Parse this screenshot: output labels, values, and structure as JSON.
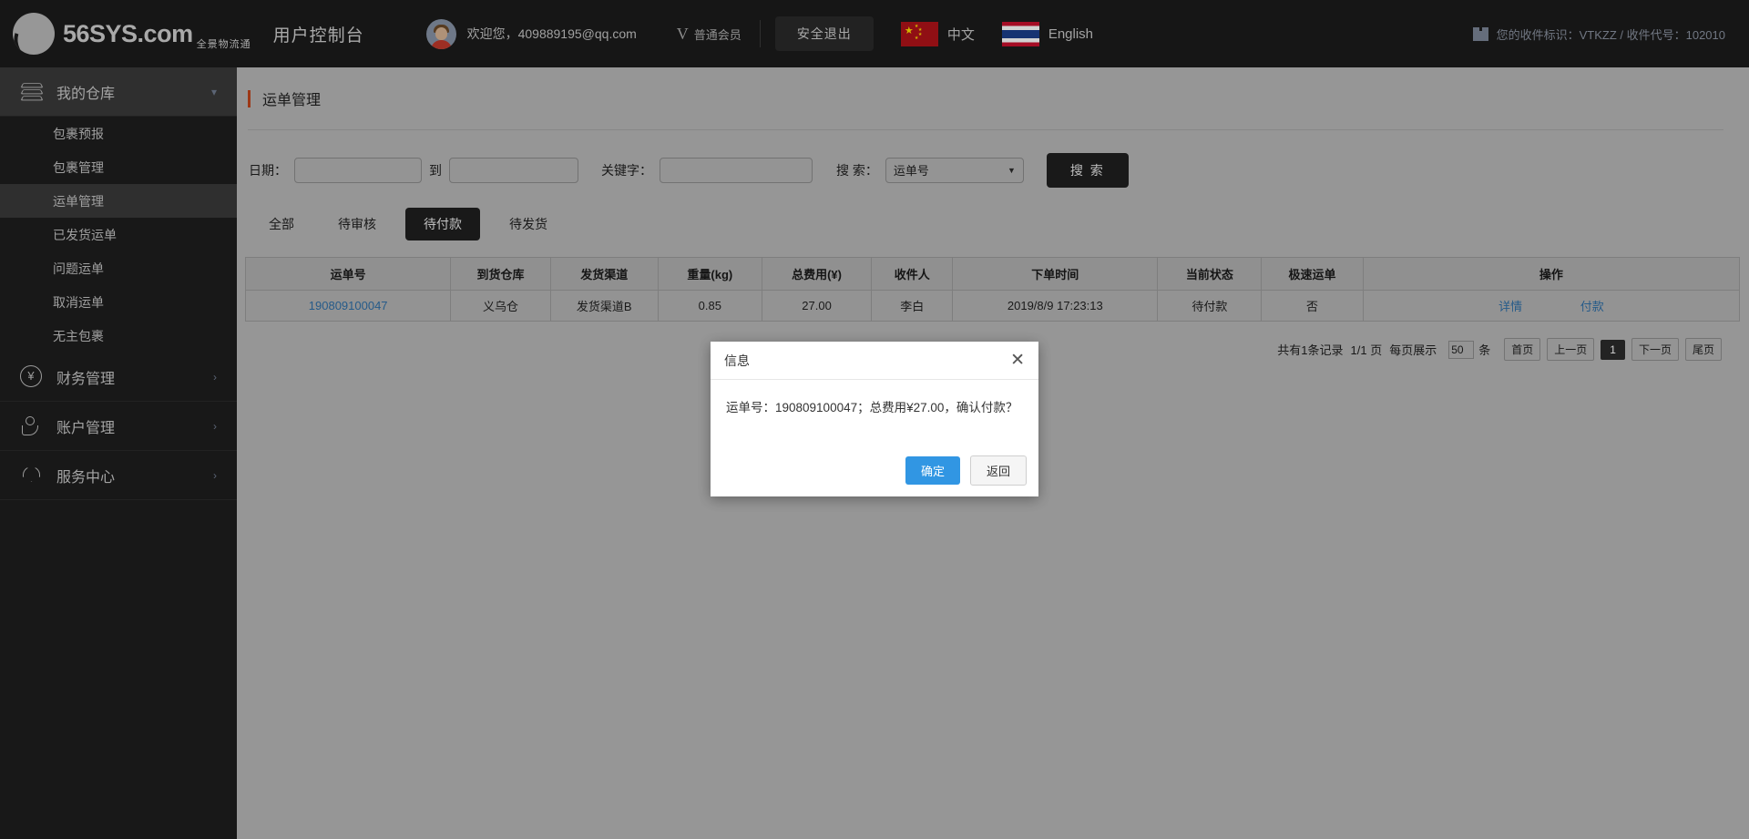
{
  "header": {
    "logo_text": "56SYS.com",
    "logo_sub": "全景物流通",
    "console_title": "用户控制台",
    "welcome": "欢迎您，409889195@qq.com",
    "vip_icon": "V",
    "vip_level": "普通会员",
    "logout_label": "安全退出",
    "languages": [
      {
        "flag": "cn-flag-icon",
        "label": "中文"
      },
      {
        "flag": "th-flag-icon",
        "label": "English"
      }
    ],
    "identity": "您的收件标识：VTKZZ / 收件代号：102010",
    "identity_icon": "box-icon"
  },
  "sidebar": {
    "groups": [
      {
        "label": "我的仓库",
        "icon": "layers-icon",
        "chevron": "chevron-down-icon",
        "active": true,
        "items": [
          {
            "label": "包裹预报",
            "active": false
          },
          {
            "label": "包裹管理",
            "active": false
          },
          {
            "label": "运单管理",
            "active": true
          },
          {
            "label": "已发货运单",
            "active": false
          },
          {
            "label": "问题运单",
            "active": false
          },
          {
            "label": "取消运单",
            "active": false
          },
          {
            "label": "无主包裹",
            "active": false
          }
        ]
      },
      {
        "label": "财务管理",
        "icon": "yen-circle-icon",
        "chevron": "chevron-right-icon",
        "active": false,
        "items": []
      },
      {
        "label": "账户管理",
        "icon": "user-icon",
        "chevron": "chevron-right-icon",
        "active": false,
        "items": []
      },
      {
        "label": "服务中心",
        "icon": "shield-icon",
        "chevron": "chevron-right-icon",
        "active": false,
        "items": []
      }
    ]
  },
  "main": {
    "page_title": "运单管理",
    "filters": {
      "date_label": "日期：",
      "date_from_value": "",
      "date_to_label": "到",
      "date_to_value": "",
      "keyword_label": "关键字：",
      "keyword_value": "",
      "search_type_label": "搜 索：",
      "search_type_value": "运单号",
      "search_type_options": [
        "运单号"
      ],
      "search_button": "搜 索"
    },
    "tabs": [
      {
        "label": "全部",
        "active": false
      },
      {
        "label": "待审核",
        "active": false
      },
      {
        "label": "待付款",
        "active": true
      },
      {
        "label": "待发货",
        "active": false
      }
    ],
    "table": {
      "columns": [
        "运单号",
        "到货仓库",
        "发货渠道",
        "重量(kg)",
        "总费用(¥)",
        "收件人",
        "下单时间",
        "当前状态",
        "极速运单",
        "操作"
      ],
      "rows": [
        {
          "waybill_no": "190809100047",
          "warehouse": "义乌仓",
          "channel": "发货渠道B",
          "weight": "0.85",
          "fee": "27.00",
          "receiver": "李白",
          "order_time": "2019/8/9 17:23:13",
          "status": "待付款",
          "express": "否",
          "action_detail": "详情",
          "action_pay": "付款"
        }
      ]
    },
    "pager": {
      "total_text": "共有1条记录",
      "page_text": "1/1 页",
      "per_page_label": "每页展示",
      "per_page_value": "50",
      "unit": "条",
      "first": "首页",
      "prev": "上一页",
      "current": "1",
      "next": "下一页",
      "last": "尾页"
    }
  },
  "modal": {
    "title": "信息",
    "close_icon": "close-icon",
    "message": "运单号：190809100047；总费用¥27.00，确认付款？",
    "ok_label": "确定",
    "cancel_label": "返回"
  },
  "colors": {
    "accent_red": "#c0451b",
    "link_blue": "#2f6fa8",
    "primary_blue": "#3196e3",
    "dark": "#1c1c1c",
    "page_bg": "#b7b7b7"
  }
}
